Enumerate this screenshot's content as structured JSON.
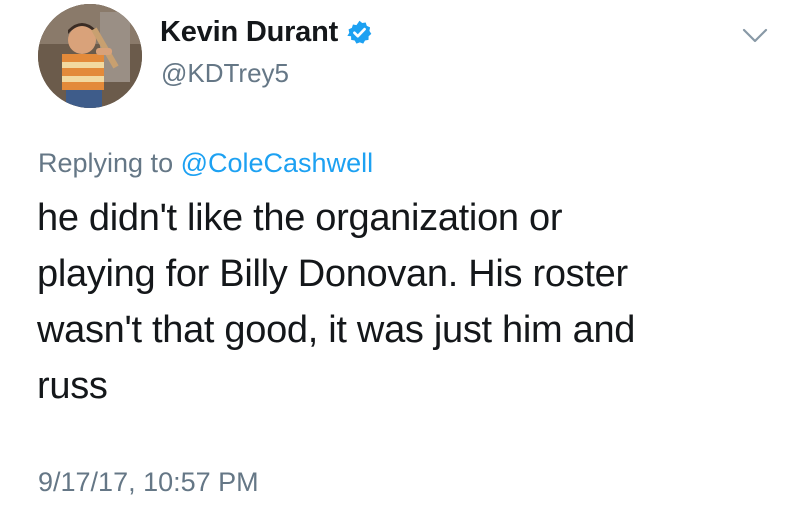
{
  "user": {
    "display_name": "Kevin Durant",
    "handle": "@KDTrey5",
    "verified_icon": "verified-badge-icon",
    "avatar_icon": "profile-avatar"
  },
  "menu": {
    "icon": "chevron-down-icon"
  },
  "reply": {
    "prefix": "Replying to",
    "mention": "@ColeCashwell"
  },
  "tweet": {
    "lines": [
      "he didn't like the organization or",
      "playing for Billy Donovan. His roster",
      "wasn't that good, it was just him and",
      "russ"
    ]
  },
  "timestamp": "9/17/17, 10:57 PM",
  "colors": {
    "link": "#1da1f2",
    "secondary_text": "#657786",
    "primary_text": "#14171a"
  }
}
